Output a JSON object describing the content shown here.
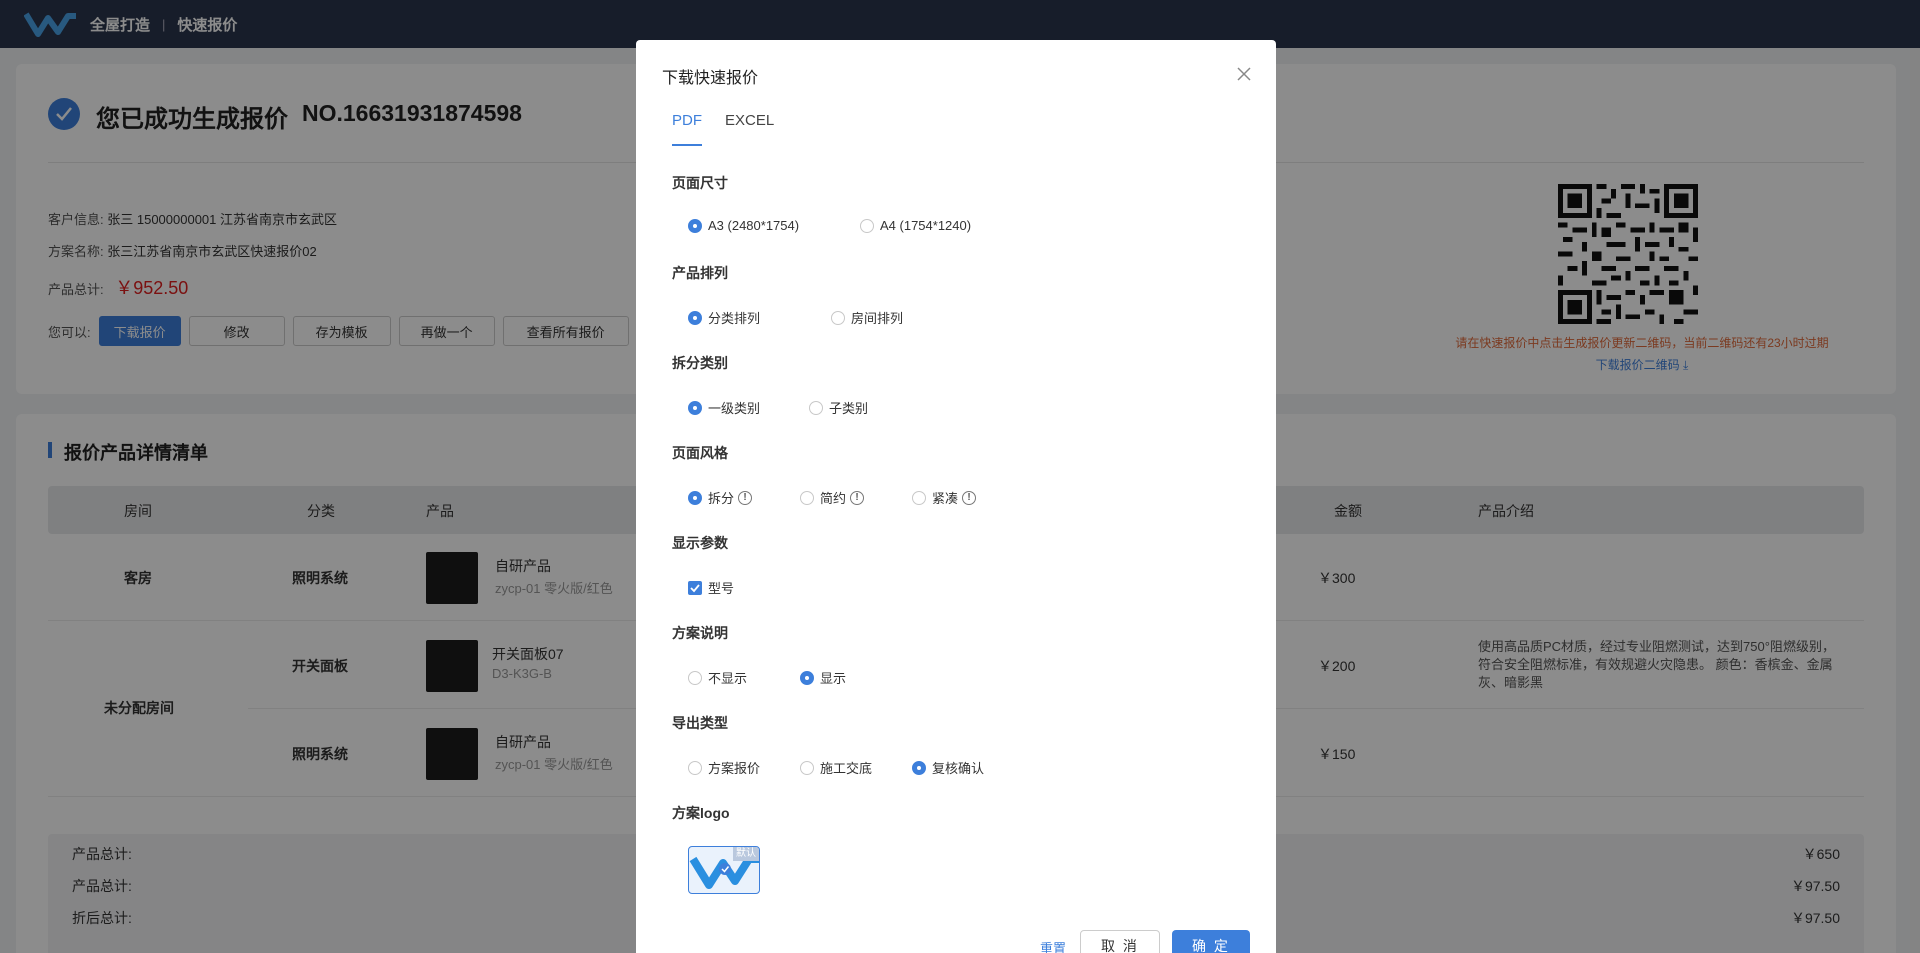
{
  "header": {
    "brand": "全屋打造",
    "separator": "|",
    "subtitle": "快速报价"
  },
  "result": {
    "title": "您已成功生成报价",
    "number": "NO.16631931874598",
    "customer_label": "客户信息:",
    "customer_value": "张三  15000000001  江苏省南京市玄武区",
    "plan_label": "方案名称:",
    "plan_value": "张三江苏省南京市玄武区快速报价02",
    "total_label": "产品总计:",
    "total_value": "￥952.50",
    "actions_label": "您可以:",
    "actions": [
      "下载报价",
      "修改",
      "存为模板",
      "再做一个",
      "查看所有报价"
    ],
    "qr_tip": "请在快速报价中点击生成报价更新二维码，当前二维码还有23小时过期",
    "qr_download": "下载报价二维码 ⤓"
  },
  "list": {
    "title": "报价产品详情清单",
    "columns": {
      "room": "房间",
      "category": "分类",
      "product": "产品",
      "amount": "金额",
      "intro": "产品介绍"
    },
    "rows": [
      {
        "room": "客房",
        "category": "照明系统",
        "name": "自研产品",
        "model": "zycp-01 零火版/红色",
        "amount": "￥300",
        "intro": ""
      },
      {
        "room": "未分配房间",
        "category": "开关面板",
        "name": "开关面板07",
        "model": "D3-K3G-B",
        "amount": "￥200",
        "intro": "使用高品质PC材质，经过专业阻燃测试，达到750°阻燃级别，符合安全阻燃标准，有效规避火灾隐患。 颜色：香槟金、金属灰、暗影黑"
      },
      {
        "room": "",
        "category": "照明系统",
        "name": "自研产品",
        "model": "zycp-01 零火版/红色",
        "amount": "￥150",
        "intro": ""
      }
    ],
    "summary": [
      {
        "label": "产品总计:",
        "value": "￥650"
      },
      {
        "label": "产品总计:",
        "value": "￥97.50"
      },
      {
        "label": "折后总计:",
        "value": "￥97.50"
      }
    ]
  },
  "dialog": {
    "title": "下载快速报价",
    "tabs": [
      "PDF",
      "EXCEL"
    ],
    "groups": {
      "page_size": {
        "title": "页面尺寸",
        "options": [
          "A3 (2480*1754)",
          "A4 (1754*1240)"
        ]
      },
      "arrange": {
        "title": "产品排列",
        "options": [
          "分类排列",
          "房间排列"
        ]
      },
      "split": {
        "title": "拆分类别",
        "options": [
          "一级类别",
          "子类别"
        ]
      },
      "style": {
        "title": "页面风格",
        "options": [
          "拆分",
          "简约",
          "紧凑"
        ]
      },
      "params": {
        "title": "显示参数",
        "options": [
          "型号"
        ]
      },
      "explain": {
        "title": "方案说明",
        "options": [
          "不显示",
          "显示"
        ]
      },
      "export": {
        "title": "导出类型",
        "options": [
          "方案报价",
          "施工交底",
          "复核确认"
        ]
      },
      "logo": {
        "title": "方案logo",
        "tag": "默认"
      }
    },
    "reset": "重置",
    "cancel": "取 消",
    "ok": "确 定"
  },
  "colors": {
    "primary": "#3d7fdb",
    "header_bg": "#2b364d",
    "price_red": "#e02020",
    "tip_orange": "#e06a3b"
  }
}
